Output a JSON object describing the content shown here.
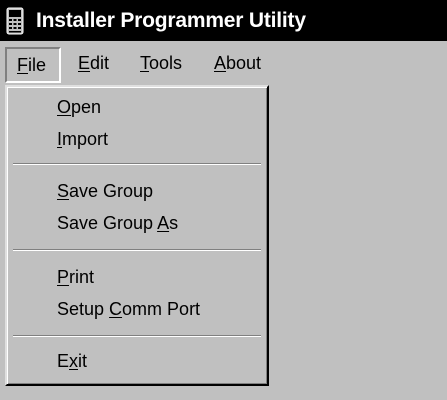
{
  "window": {
    "title": "Installer Programmer Utility",
    "icon": "handheld-programmer-icon"
  },
  "menubar": {
    "items": [
      {
        "pre": "",
        "key": "F",
        "post": "ile",
        "active": true
      },
      {
        "pre": "",
        "key": "E",
        "post": "dit",
        "active": false
      },
      {
        "pre": "",
        "key": "T",
        "post": "ools",
        "active": false
      },
      {
        "pre": "",
        "key": "A",
        "post": "bout",
        "active": false
      }
    ]
  },
  "file_menu": {
    "items": [
      {
        "pre": "",
        "key": "O",
        "post": "pen"
      },
      {
        "pre": "",
        "key": "I",
        "post": "mport"
      },
      {
        "pre": "",
        "key": "S",
        "post": "ave Group"
      },
      {
        "pre": "Save Group ",
        "key": "A",
        "post": "s"
      },
      {
        "pre": "",
        "key": "P",
        "post": "rint"
      },
      {
        "pre": "Setup ",
        "key": "C",
        "post": "omm Port"
      },
      {
        "pre": "E",
        "key": "x",
        "post": "it"
      }
    ]
  },
  "colors": {
    "titlebar_bg": "#000000",
    "titlebar_text": "#ffffff",
    "face": "#c0c0c0",
    "shadow": "#808080",
    "highlight": "#ffffff"
  }
}
